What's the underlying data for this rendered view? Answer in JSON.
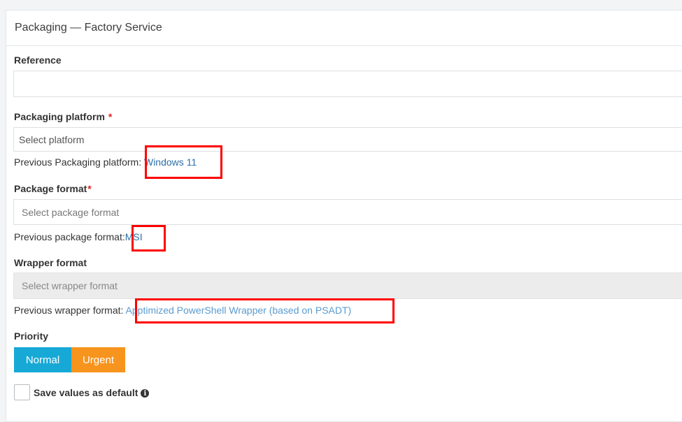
{
  "panel": {
    "title": "Packaging — Factory Service"
  },
  "reference": {
    "label": "Reference",
    "value": ""
  },
  "platform": {
    "label": "Packaging platform",
    "required_mark": "*",
    "placeholder": "Select platform",
    "previous_label": "Previous Packaging platform:",
    "previous_value": "Windows 11"
  },
  "package_format": {
    "label": "Package format",
    "required_mark": "*",
    "placeholder": "Select package format",
    "previous_label": "Previous package format:",
    "previous_value": "MSI"
  },
  "wrapper_format": {
    "label": "Wrapper format",
    "placeholder": "Select wrapper format",
    "previous_label": "Previous wrapper format:",
    "previous_value": "Apptimized PowerShell Wrapper (based on PSADT)"
  },
  "priority": {
    "label": "Priority",
    "options": [
      "Normal",
      "Urgent"
    ],
    "selected": "Normal",
    "colors": {
      "normal": "#17a9d6",
      "urgent": "#f7941d"
    }
  },
  "save_default": {
    "label": "Save values as default",
    "checked": false,
    "icon": "info-icon"
  },
  "annotation_color": "#ff0000"
}
